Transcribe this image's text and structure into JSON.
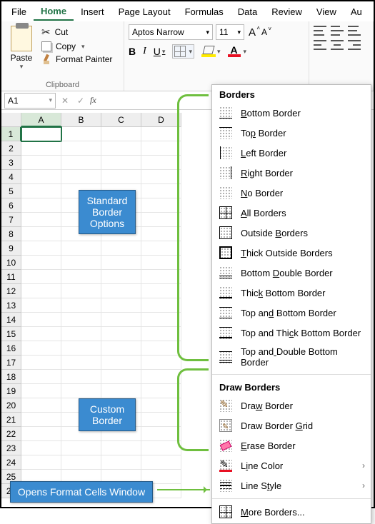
{
  "menu": {
    "items": [
      "File",
      "Home",
      "Insert",
      "Page Layout",
      "Formulas",
      "Data",
      "Review",
      "View",
      "Au"
    ],
    "active": 1
  },
  "clipboard": {
    "paste": "Paste",
    "cut": "Cut",
    "copy": "Copy",
    "format_painter": "Format Painter",
    "group_label": "Clipboard"
  },
  "font": {
    "name": "Aptos Narrow",
    "size": "11",
    "bold": "B",
    "italic": "I",
    "underline": "U"
  },
  "name_box": "A1",
  "columns": [
    "A",
    "B",
    "C",
    "D"
  ],
  "rows_count": 26,
  "active_cell": {
    "row": 1,
    "col": 0
  },
  "dropdown": {
    "section_borders": "Borders",
    "items1": [
      {
        "label": "Bottom Border",
        "u": 0,
        "icon": "bi-bottom"
      },
      {
        "label": "Top Border",
        "u": 2,
        "icon": "bi-top"
      },
      {
        "label": "Left Border",
        "u": 0,
        "icon": "bi-left"
      },
      {
        "label": "Right Border",
        "u": 0,
        "icon": "bi-right"
      },
      {
        "label": "No Border",
        "u": 0,
        "icon": ""
      },
      {
        "label": "All Borders",
        "u": 0,
        "icon": "bi-all"
      },
      {
        "label": "Outside Borders",
        "u": 8,
        "icon": "bi-outside"
      },
      {
        "label": "Thick Outside Borders",
        "u": 0,
        "icon": "bi-thickout"
      },
      {
        "label": "Bottom Double Border",
        "u": 7,
        "icon": "bi-botdbl"
      },
      {
        "label": "Thick Bottom Border",
        "u": 4,
        "icon": "bi-thickbot"
      },
      {
        "label": "Top and Bottom Border",
        "u": 6,
        "icon": "bi-topbot"
      },
      {
        "label": "Top and Thick Bottom Border",
        "u": 11,
        "icon": "bi-topthickbot"
      },
      {
        "label": "Top and Double Bottom Border",
        "u": 7,
        "icon": "bi-topdblbot"
      }
    ],
    "section_draw": "Draw Borders",
    "items2": [
      {
        "label": "Draw Border",
        "u": 3,
        "icon": "bi-pencil",
        "sub": false
      },
      {
        "label": "Draw Border Grid",
        "u": 12,
        "icon": "bi-grid",
        "sub": false
      },
      {
        "label": "Erase Border",
        "u": 0,
        "icon": "bi-erase",
        "sub": false
      },
      {
        "label": "Line Color",
        "u": 1,
        "icon": "bi-linecolor",
        "sub": true
      },
      {
        "label": "Line Style",
        "u": 6,
        "icon": "bi-linestyle",
        "sub": true
      }
    ],
    "more": {
      "label": "More Borders...",
      "u": 0,
      "icon": "bi-more"
    }
  },
  "callouts": {
    "standard": "Standard Border Options",
    "custom": "Custom Border",
    "opens": "Opens Format Cells Window"
  }
}
